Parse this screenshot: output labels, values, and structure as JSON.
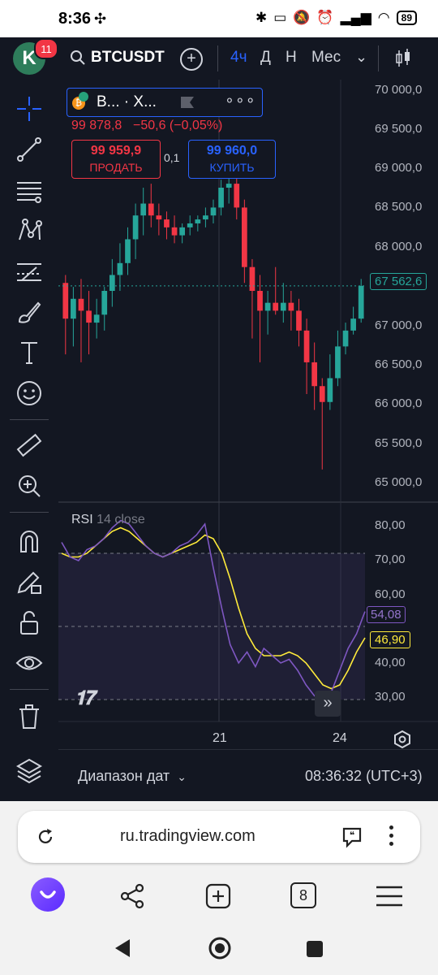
{
  "status_bar": {
    "time": "8:36",
    "battery": "89"
  },
  "topbar": {
    "avatar_letter": "K",
    "notifications": "11",
    "symbol": "BTCUSDT",
    "timeframes": [
      "4ч",
      "Д",
      "Н",
      "Мес"
    ],
    "active_timeframe": "4ч"
  },
  "legend": {
    "name": "B... · X...",
    "price": "99 878,8",
    "change": "−50,6 (−0,05%)",
    "sell_price": "99 959,9",
    "sell_label": "ПРОДАТЬ",
    "spread": "0,1",
    "buy_price": "99 960,0",
    "buy_label": "КУПИТЬ"
  },
  "price_axis": [
    "70 000,0",
    "69 500,0",
    "69 000,0",
    "68 500,0",
    "68 000,0",
    "67 000,0",
    "66 500,0",
    "66 000,0",
    "65 500,0",
    "65 000,0"
  ],
  "last_price_label": "67 562,6",
  "rsi": {
    "title": "RSI",
    "params": "14 close",
    "axis": [
      "80,00",
      "70,00",
      "60,00",
      "40,00",
      "30,00"
    ],
    "rsi_value": "54,08",
    "ma_value": "46,90"
  },
  "time_axis": [
    "21",
    "24"
  ],
  "bottom": {
    "date_range": "Диапазон дат",
    "clock": "08:36:32 (UTC+3)"
  },
  "browser": {
    "url": "ru.tradingview.com",
    "tabs_count": "8"
  },
  "colors": {
    "up": "#26a69a",
    "down": "#f23645",
    "accent": "#2962ff",
    "rsi_line": "#7e57c2",
    "rsi_ma": "#ffeb3b",
    "panel_bg": "#131722"
  },
  "chart_data": {
    "type": "candlestick",
    "ylim": [
      64900,
      70100
    ],
    "candles": [
      {
        "o": 67600,
        "h": 67700,
        "l": 66700,
        "c": 67150
      },
      {
        "o": 67150,
        "h": 67550,
        "l": 66800,
        "c": 67400
      },
      {
        "o": 67400,
        "h": 67650,
        "l": 66600,
        "c": 67250
      },
      {
        "o": 67250,
        "h": 67500,
        "l": 66700,
        "c": 67100
      },
      {
        "o": 67100,
        "h": 67400,
        "l": 66900,
        "c": 67200
      },
      {
        "o": 67200,
        "h": 67550,
        "l": 67000,
        "c": 67500
      },
      {
        "o": 67500,
        "h": 67900,
        "l": 67300,
        "c": 67700
      },
      {
        "o": 67700,
        "h": 68100,
        "l": 67500,
        "c": 67850
      },
      {
        "o": 67850,
        "h": 68300,
        "l": 67700,
        "c": 68150
      },
      {
        "o": 68150,
        "h": 68600,
        "l": 67900,
        "c": 68450
      },
      {
        "o": 68450,
        "h": 68800,
        "l": 68200,
        "c": 68600
      },
      {
        "o": 68600,
        "h": 68850,
        "l": 68300,
        "c": 68450
      },
      {
        "o": 68450,
        "h": 68600,
        "l": 68200,
        "c": 68400
      },
      {
        "o": 68400,
        "h": 68500,
        "l": 68150,
        "c": 68300
      },
      {
        "o": 68300,
        "h": 68450,
        "l": 68100,
        "c": 68200
      },
      {
        "o": 68200,
        "h": 68350,
        "l": 68100,
        "c": 68300
      },
      {
        "o": 68300,
        "h": 68450,
        "l": 68200,
        "c": 68350
      },
      {
        "o": 68350,
        "h": 68450,
        "l": 68250,
        "c": 68400
      },
      {
        "o": 68400,
        "h": 68550,
        "l": 68300,
        "c": 68450
      },
      {
        "o": 68450,
        "h": 68650,
        "l": 68350,
        "c": 68550
      },
      {
        "o": 68550,
        "h": 68900,
        "l": 68450,
        "c": 68800
      },
      {
        "o": 68800,
        "h": 69400,
        "l": 68600,
        "c": 68850
      },
      {
        "o": 68850,
        "h": 68950,
        "l": 68400,
        "c": 68550
      },
      {
        "o": 68550,
        "h": 68650,
        "l": 67600,
        "c": 67800
      },
      {
        "o": 67800,
        "h": 67900,
        "l": 66900,
        "c": 67500
      },
      {
        "o": 67500,
        "h": 67700,
        "l": 66600,
        "c": 67250
      },
      {
        "o": 67250,
        "h": 67500,
        "l": 66950,
        "c": 67350
      },
      {
        "o": 67350,
        "h": 67800,
        "l": 67200,
        "c": 67250
      },
      {
        "o": 67250,
        "h": 67600,
        "l": 67100,
        "c": 67350
      },
      {
        "o": 67350,
        "h": 67500,
        "l": 67000,
        "c": 67250
      },
      {
        "o": 67250,
        "h": 67400,
        "l": 66800,
        "c": 67000
      },
      {
        "o": 67000,
        "h": 67150,
        "l": 66200,
        "c": 66600
      },
      {
        "o": 66600,
        "h": 66850,
        "l": 66000,
        "c": 66300
      },
      {
        "o": 66300,
        "h": 66400,
        "l": 65250,
        "c": 66100
      },
      {
        "o": 66100,
        "h": 66700,
        "l": 66000,
        "c": 66400
      },
      {
        "o": 66400,
        "h": 67000,
        "l": 66300,
        "c": 66800
      },
      {
        "o": 66800,
        "h": 67100,
        "l": 66700,
        "c": 67000
      },
      {
        "o": 67000,
        "h": 67300,
        "l": 66950,
        "c": 67150
      },
      {
        "o": 67150,
        "h": 67650,
        "l": 67100,
        "c": 67562.6
      }
    ],
    "rsi": [
      73,
      69,
      68,
      71,
      72,
      74,
      77,
      79,
      78,
      75,
      72,
      70,
      69,
      70,
      72,
      73,
      75,
      78,
      66,
      55,
      45,
      40,
      43,
      39,
      44,
      42,
      40,
      41,
      38,
      34,
      31,
      30,
      32,
      38,
      44,
      48,
      54.08
    ],
    "rsi_ma": [
      70,
      69,
      69,
      70,
      72,
      74,
      76,
      77,
      76,
      74,
      72,
      70,
      69,
      70,
      71,
      72,
      73,
      75,
      74,
      70,
      63,
      55,
      48,
      44,
      42,
      42,
      42,
      43,
      42,
      40,
      37,
      34,
      33,
      34,
      38,
      43,
      46.9
    ],
    "rsi_ylim": [
      24,
      84
    ]
  }
}
